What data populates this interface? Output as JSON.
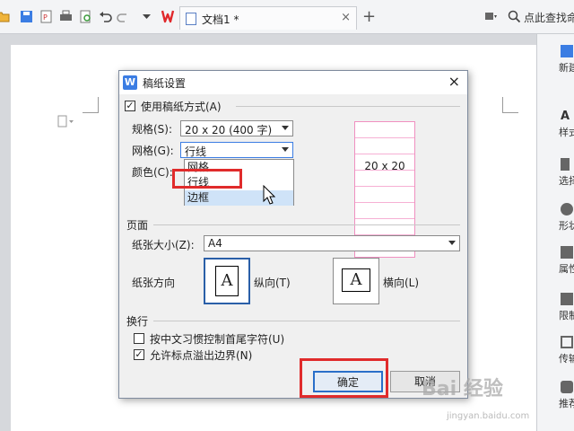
{
  "tab": {
    "title": "文档1 *",
    "close": "×"
  },
  "toolbar": {
    "new_tab": "+",
    "search_text": "点此查找命令"
  },
  "sidebar": {
    "items": [
      "新建",
      "样式",
      "选择",
      "形状",
      "属性",
      "限制",
      "传输",
      "推荐"
    ]
  },
  "dialog": {
    "title": "稿纸设置",
    "close": "×",
    "app_icon_letter": "W",
    "use_grid_paper": "使用稿纸方式(A)",
    "spec_label": "规格(S):",
    "spec_value": "20 x 20 (400 字)",
    "grid_label": "网格(G):",
    "grid_value": "行线",
    "color_label": "颜色(C):",
    "grid_options": [
      "网格",
      "行线",
      "边框"
    ],
    "preview_label": "20 x 20",
    "page_section": "页面",
    "paper_size_label": "纸张大小(Z):",
    "paper_size_value": "A4",
    "orientation_label": "纸张方向",
    "page_glyph": "A",
    "portrait_label": "纵向(T)",
    "landscape_label": "横向(L)",
    "wrap_section": "换行",
    "wrap_option_1": "按中文习惯控制首尾字符(U)",
    "wrap_option_2": "允许标点溢出边界(N)",
    "ok_label": "确定",
    "cancel_label": "取消"
  },
  "watermark": {
    "brand": "Bai 经验",
    "url": "jingyan.baidu.com"
  },
  "colors": {
    "accent": "#2a6fc9",
    "highlight_red": "#e02b2b",
    "grid_pink": "#f090c0"
  }
}
